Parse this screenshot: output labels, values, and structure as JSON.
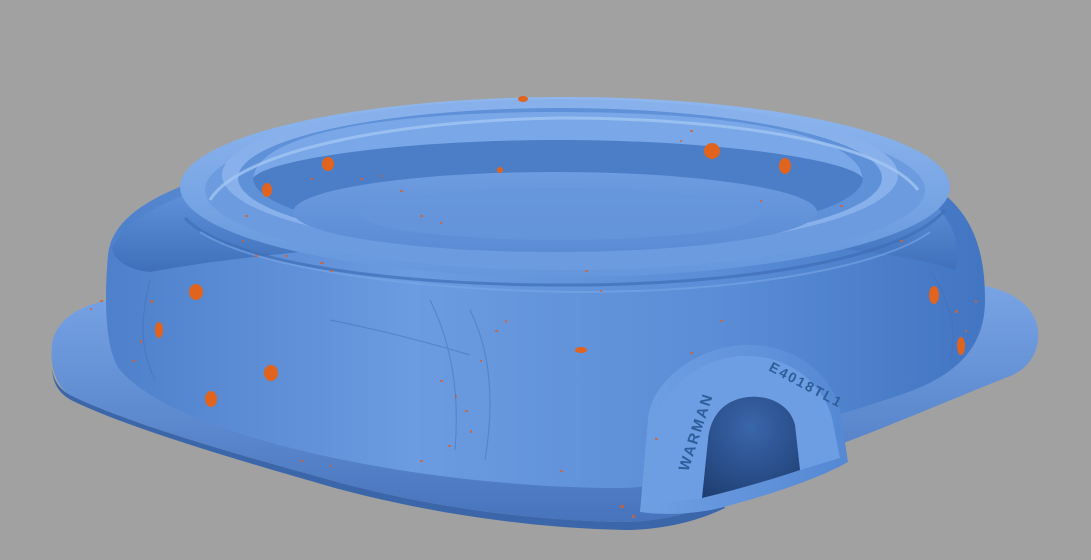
{
  "scene": {
    "background_color": "#a1a1a1",
    "surface_color": "#5b8fd8",
    "surface_shadow_color": "#3e6fb8",
    "surface_highlight_color": "#86b2ee",
    "deviation_color": "#e0631e"
  },
  "casting_markings": {
    "maker": "WARMAN",
    "part_number": "E4018TL1"
  }
}
